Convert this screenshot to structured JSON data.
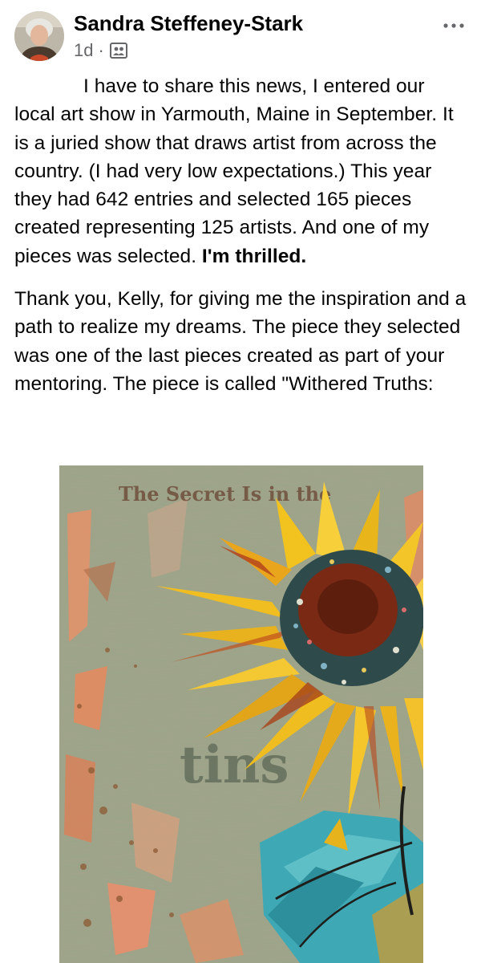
{
  "post": {
    "author": "Sandra Steffeney-Stark",
    "time": "1d",
    "separator": "·",
    "privacy_icon": "friends-icon",
    "more_icon": "more-dots-icon",
    "paragraph1_text": "I have to share this news, I entered our local art show in Yarmouth, Maine in September.  It is a juried show that draws artist from across the country.  (I had very low expectations.)  This year they had 642 entries and selected 165 pieces created representing 125 artists.  And one of my pieces was selected.",
    "paragraph1_bold": "I'm thrilled.",
    "paragraph2_text": "Thank you, Kelly, for giving me the inspiration and a path to realize my dreams.  The piece they selected was one of the last pieces created as part of your mentoring. The piece is called \"Withered Truths:"
  },
  "artwork": {
    "overlay_text_top": "The Secret Is in the",
    "overlay_text_mid": "tins"
  },
  "colors": {
    "name_text": "#050505",
    "meta_text": "#65676b",
    "background": "#ffffff"
  }
}
